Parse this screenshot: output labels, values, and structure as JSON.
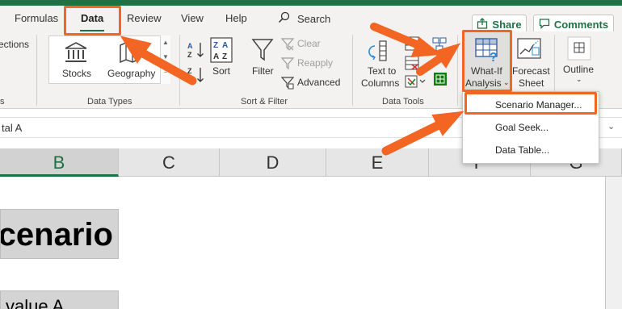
{
  "tabs": {
    "formulas": "Formulas",
    "data": "Data",
    "review": "Review",
    "view": "View",
    "help": "Help"
  },
  "search": {
    "label": "Search"
  },
  "header_buttons": {
    "share": "Share",
    "comments": "Comments"
  },
  "ribbon": {
    "connections_label": "ections",
    "connections_group_label": "s",
    "data_types": {
      "stocks": "Stocks",
      "geography": "Geography",
      "group_label": "Data Types"
    },
    "sort_filter": {
      "sort": "Sort",
      "filter": "Filter",
      "clear": "Clear",
      "reapply": "Reapply",
      "advanced": "Advanced",
      "group_label": "Sort & Filter"
    },
    "data_tools": {
      "text_to_columns_line1": "Text to",
      "text_to_columns_line2": "Columns",
      "group_label": "Data Tools"
    },
    "forecast": {
      "whatif_line1": "What-If",
      "whatif_line2": "Analysis",
      "forecast_line1": "Forecast",
      "forecast_line2": "Sheet"
    },
    "outline": {
      "label": "Outline"
    }
  },
  "whatif_menu": {
    "items": [
      "Scenario Manager...",
      "Goal Seek...",
      "Data Table..."
    ]
  },
  "formula_bar": {
    "text": "tal A"
  },
  "columns": [
    "B",
    "C",
    "D",
    "E",
    "F",
    "G"
  ],
  "cells": {
    "title": "Scenario A",
    "sub": "value A"
  },
  "colors": {
    "accent_green": "#1e7145",
    "highlight_orange": "#f26522",
    "ribbon_bg": "#f3f2f1"
  }
}
